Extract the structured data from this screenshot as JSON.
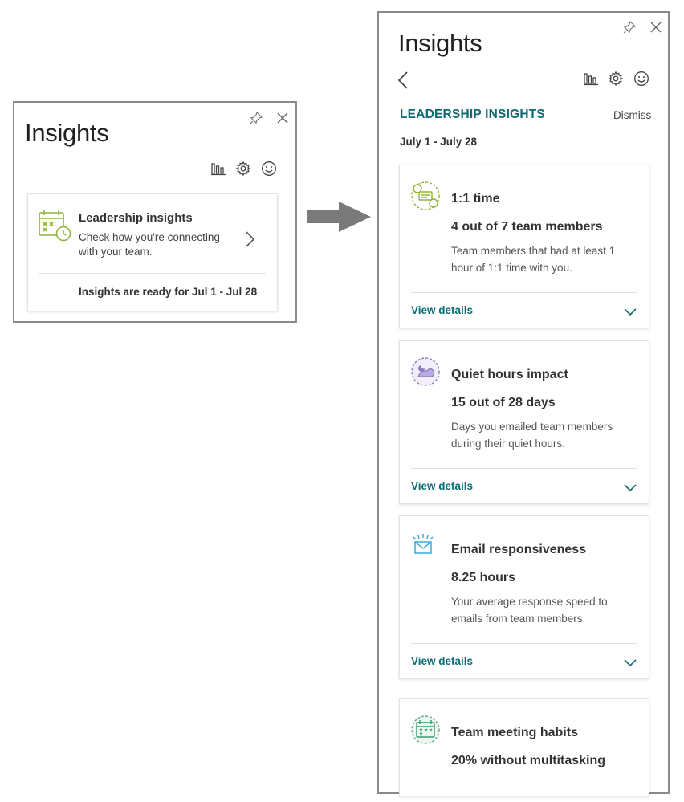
{
  "small_pane": {
    "title": "Insights",
    "card": {
      "title": "Leadership insights",
      "description": "Check how you're connecting with your team.",
      "ready_text": "Insights are ready for Jul 1 - Jul 28"
    },
    "icons": [
      "pin-icon",
      "close-icon",
      "bar-chart-icon",
      "gear-icon",
      "smiley-icon",
      "calendar-clock-icon",
      "chevron-right-icon"
    ]
  },
  "large_pane": {
    "title": "Insights",
    "section_title": "LEADERSHIP INSIGHTS",
    "dismiss_label": "Dismiss",
    "date_range": "July 1 - July 28",
    "view_details_label": "View details",
    "cards": [
      {
        "title": "1:1 time",
        "metric": "4 out of 7 team members",
        "description": "Team members that had at least 1 hour of 1:1 time with you.",
        "icon": "one-on-one-icon"
      },
      {
        "title": "Quiet hours impact",
        "metric": "15 out of 28 days",
        "description": "Days you emailed team members during their quiet hours.",
        "icon": "quiet-hours-icon"
      },
      {
        "title": "Email responsiveness",
        "metric": "8.25 hours",
        "description": "Your average response speed to emails from team members.",
        "icon": "email-icon"
      },
      {
        "title": "Team meeting habits",
        "metric": "20% without multitasking",
        "icon": "meeting-calendar-icon"
      }
    ]
  },
  "colors": {
    "accent_teal": "#0f6b73",
    "frame_gray": "#8a8a8a",
    "arrow_gray": "#7a7a7a",
    "icon_green": "#8fb33b",
    "icon_purple": "#8a7cc2",
    "icon_blue": "#2aa4d8"
  }
}
